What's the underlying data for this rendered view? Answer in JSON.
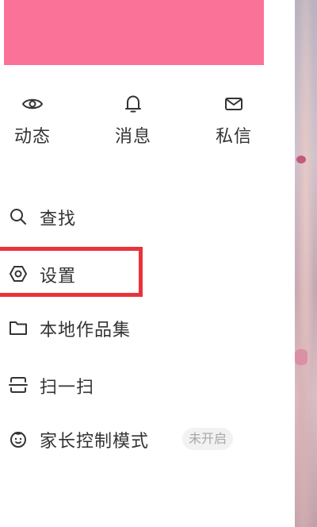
{
  "quick_actions": [
    {
      "label": "动态",
      "icon": "eye-icon"
    },
    {
      "label": "消息",
      "icon": "bell-icon"
    },
    {
      "label": "私信",
      "icon": "mail-icon"
    }
  ],
  "menu": {
    "items": [
      {
        "label": "查找",
        "icon": "search-icon"
      },
      {
        "label": "设置",
        "icon": "settings-icon"
      },
      {
        "label": "本地作品集",
        "icon": "folder-icon"
      },
      {
        "label": "扫一扫",
        "icon": "scan-icon"
      },
      {
        "label": "家长控制模式",
        "icon": "parent-control-icon",
        "badge": "未开启"
      }
    ]
  },
  "colors": {
    "banner": "#fb7299",
    "highlight": "#e8333a",
    "text": "#333333",
    "badge_text": "#a8a8a8",
    "badge_bg": "#f2f2f2"
  }
}
